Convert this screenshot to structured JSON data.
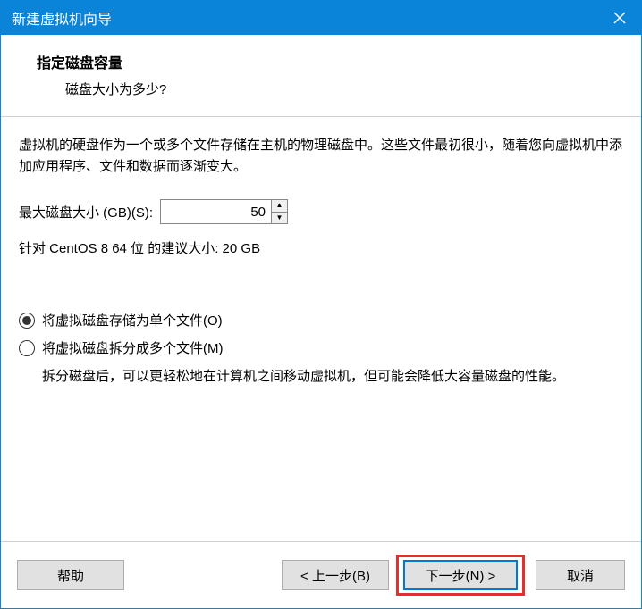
{
  "titlebar": {
    "title": "新建虚拟机向导"
  },
  "header": {
    "title": "指定磁盘容量",
    "subtitle": "磁盘大小为多少?"
  },
  "content": {
    "description": "虚拟机的硬盘作为一个或多个文件存储在主机的物理磁盘中。这些文件最初很小，随着您向虚拟机中添加应用程序、文件和数据而逐渐变大。",
    "size_label": "最大磁盘大小 (GB)(S):",
    "size_value": "50",
    "recommend": "针对 CentOS 8 64 位 的建议大小: 20 GB",
    "radio_single": "将虚拟磁盘存储为单个文件(O)",
    "radio_split": "将虚拟磁盘拆分成多个文件(M)",
    "split_note": "拆分磁盘后，可以更轻松地在计算机之间移动虚拟机，但可能会降低大容量磁盘的性能。"
  },
  "footer": {
    "help": "帮助",
    "back": "< 上一步(B)",
    "next": "下一步(N) >",
    "cancel": "取消"
  }
}
